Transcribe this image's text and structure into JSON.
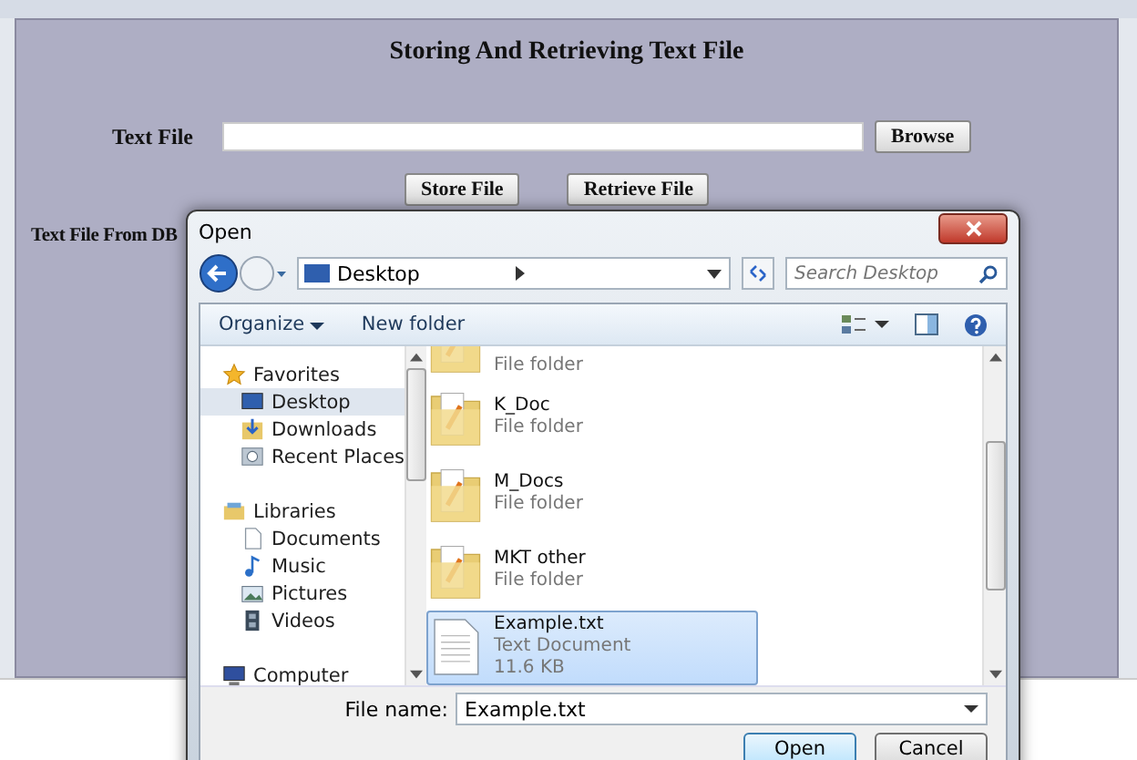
{
  "app_window": {
    "heading": "Storing And Retrieving Text File",
    "text_file_label": "Text File",
    "browse_button": "Browse",
    "store_button": "Store File",
    "retrieve_button": "Retrieve File",
    "db_label": "Text File From DB"
  },
  "dialog": {
    "title": "Open",
    "address": "Desktop",
    "search_placeholder": "Search Desktop",
    "toolbar": [
      {
        "label": "Organize",
        "kind": "menu"
      },
      {
        "label": "New folder",
        "kind": "button"
      }
    ],
    "nav": [
      {
        "label": "Favorites",
        "selected": false,
        "children": [
          {
            "label": "Desktop",
            "selected": true
          },
          {
            "label": "Downloads",
            "selected": false
          },
          {
            "label": "Recent Places",
            "selected": false
          }
        ]
      },
      {
        "label": "Libraries",
        "selected": false,
        "children": [
          {
            "label": "Documents",
            "selected": false
          },
          {
            "label": "Music",
            "selected": false
          },
          {
            "label": "Pictures",
            "selected": false
          },
          {
            "label": "Videos",
            "selected": false
          }
        ]
      },
      {
        "label": "Computer",
        "selected": false
      }
    ],
    "files": [
      {
        "kind": "folder",
        "type": "File folder",
        "selected": false
      },
      {
        "kind": "folder",
        "name": "K_Doc",
        "type": "File folder",
        "selected": false
      },
      {
        "kind": "folder",
        "name": "M_Docs",
        "type": "File folder",
        "selected": false
      },
      {
        "kind": "folder",
        "name": "MKT other",
        "type": "File folder",
        "selected": false
      },
      {
        "kind": "document",
        "name": "Example.txt",
        "type": "Text Document",
        "size": "11.6 KB",
        "selected": true
      }
    ],
    "file_name_label": "File name:",
    "file_name": "Example.txt",
    "open_button": "Open",
    "cancel_button": "Cancel"
  }
}
